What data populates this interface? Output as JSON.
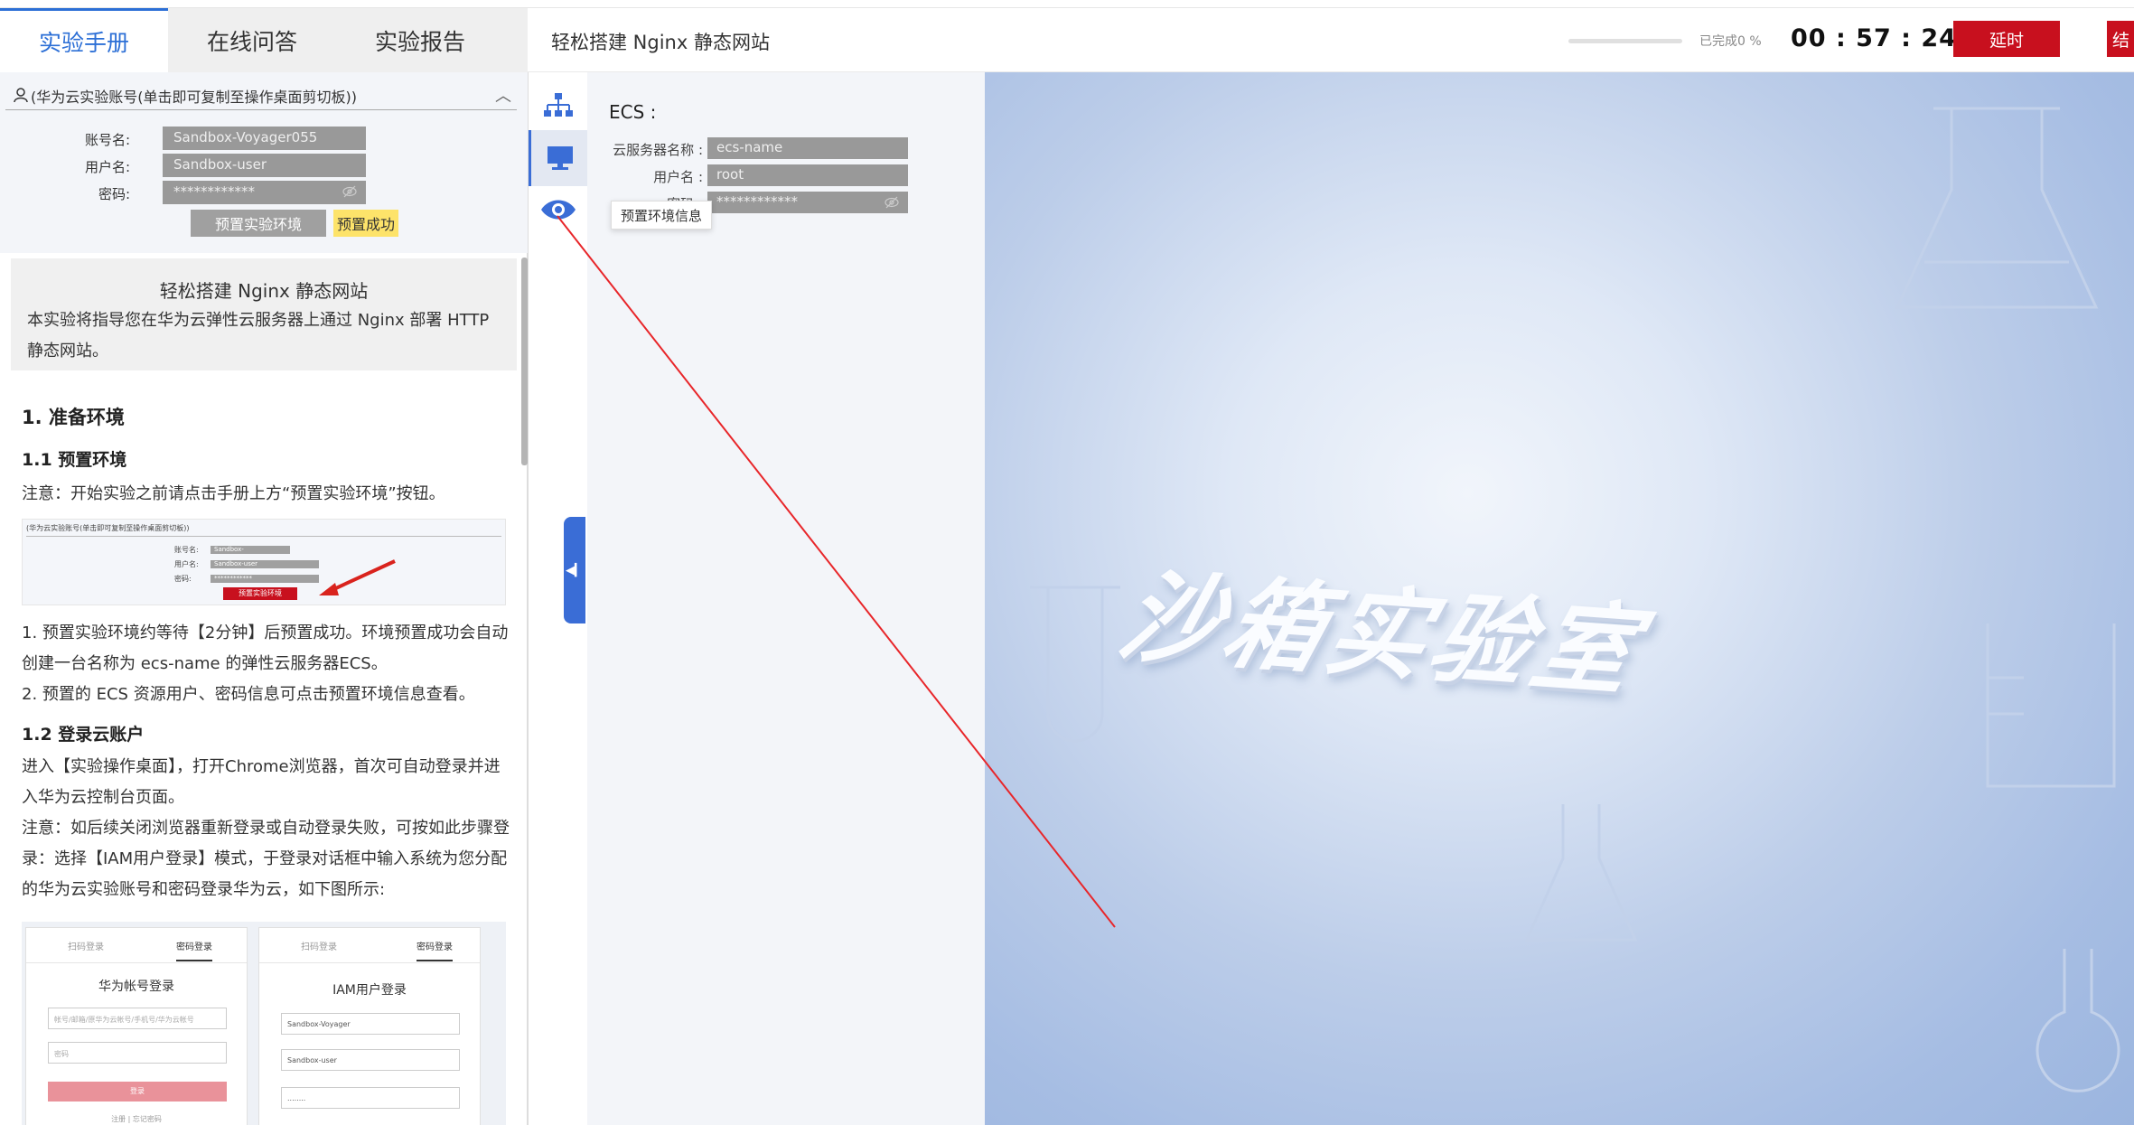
{
  "tabs": [
    {
      "label": "实验手册",
      "active": true
    },
    {
      "label": "在线问答",
      "active": false
    },
    {
      "label": "实验报告",
      "active": false
    }
  ],
  "header": {
    "title": "轻松搭建 Nginx 静态网站",
    "progress_label": "已完成0 %",
    "progress_percent": 0,
    "timer": "00 : 57 : 24",
    "delay_button": "延时",
    "end_button_partial": "结"
  },
  "account": {
    "header": "(华为云实验账号(单击即可复制至操作桌面剪切板))",
    "rows": [
      {
        "label": "账号名:",
        "value": "Sandbox-Voyager055"
      },
      {
        "label": "用户名:",
        "value": "Sandbox-user"
      },
      {
        "label": "密码:",
        "value": "************"
      }
    ],
    "preset_button": "预置实验环境",
    "preset_status": "预置成功"
  },
  "manual": {
    "intro_title": "轻松搭建 Nginx 静态网站",
    "intro_desc": "本实验将指导您在华为云弹性云服务器上通过 Nginx 部署 HTTP 静态网站。",
    "h1": "1. 准备环境",
    "h11": "1.1 预置环境",
    "note1": "注意：开始实验之前请点击手册上方“预置实验环境”按钮。",
    "p1": "1. 预置实验环境约等待【2分钟】后预置成功。环境预置成功会自动创建一台名称为 ecs-name 的弹性云服务器ECS。",
    "p2": "2. 预置的 ECS 资源用户、密码信息可点击预置环境信息查看。",
    "h12": "1.2 登录云账户",
    "p3": "进入【实验操作桌面】，打开Chrome浏览器，首次可自动登录并进入华为云控制台页面。",
    "p4": "注意：如后续关闭浏览器重新登录或自动登录失败，可按如此步骤登录：选择【IAM用户登录】模式，于登录对话框中输入系统为您分配的华为云实验账号和密码登录华为云，如下图所示:",
    "thumb": {
      "header": "(华为云实验账号(单击即可复制至操作桌面剪切板))",
      "label_account": "账号名:",
      "label_user": "用户名:",
      "label_pwd": "密码:",
      "val_account": "Sandbox-",
      "val_user": "Sandbox-user",
      "val_pwd": "************",
      "button": "预置实验环境"
    },
    "login_left": {
      "tab1": "扫码登录",
      "tab2": "密码登录",
      "title": "华为帐号登录",
      "input1": "帐号/邮箱/原华为云帐号/手机号/华为云帐号",
      "input2": "密码",
      "button": "登录",
      "links": "注册 | 忘记密码"
    },
    "login_right": {
      "tab1": "扫码登录",
      "tab2": "密码登录",
      "title": "IAM用户登录",
      "input1": "Sandbox-Voyager",
      "input2": "Sandbox-user",
      "input3": "........"
    }
  },
  "info_panel": {
    "title": "ECS :",
    "rows": [
      {
        "label": "云服务器名称 :",
        "value": "ecs-name"
      },
      {
        "label": "用户名 :",
        "value": "root"
      },
      {
        "label": "密码 :",
        "value": "************"
      }
    ],
    "tooltip": "预置环境信息"
  },
  "desktop": {
    "brand_text": "沙箱实验室"
  },
  "colors": {
    "accent_blue": "#2c6fd6",
    "brand_red": "#c8101e",
    "panel_bg": "#f3f5f9",
    "badge_yellow": "#fde36a"
  },
  "icons": [
    "org-tree-icon",
    "monitor-icon",
    "eye-icon",
    "collapse-arrow-icon",
    "user-icon",
    "eye-off-icon",
    "chevron-up-icon"
  ]
}
